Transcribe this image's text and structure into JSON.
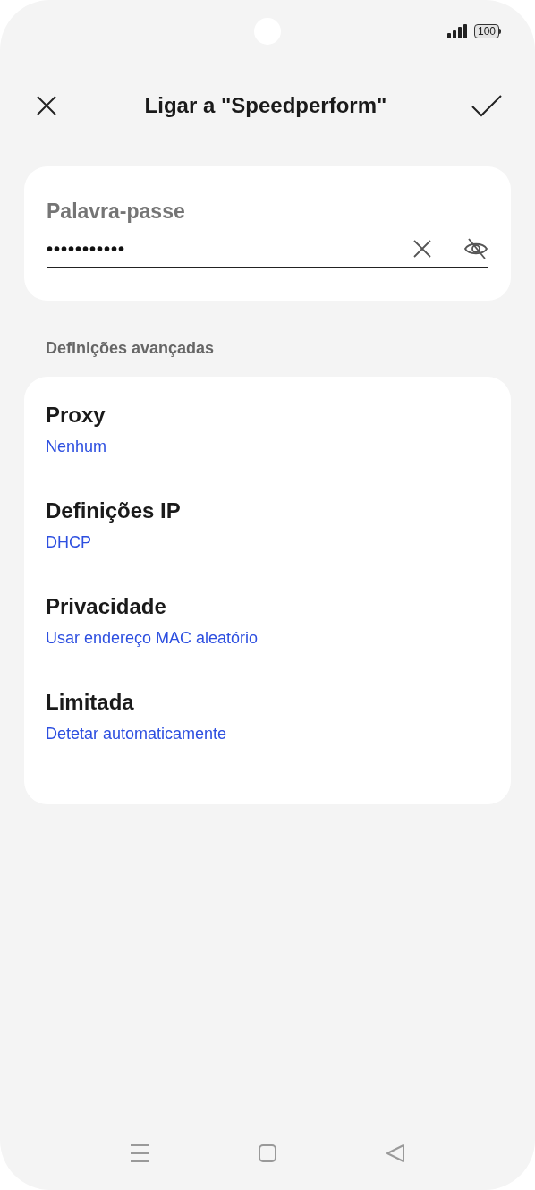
{
  "status_bar": {
    "battery": "100"
  },
  "header": {
    "title": "Ligar a \"Speedperform\""
  },
  "password": {
    "label": "Palavra-passe",
    "value": "•••••••••••"
  },
  "section_title": "Definições avançadas",
  "settings": [
    {
      "title": "Proxy",
      "value": "Nenhum"
    },
    {
      "title": "Definições IP",
      "value": "DHCP"
    },
    {
      "title": "Privacidade",
      "value": "Usar endereço MAC aleatório"
    },
    {
      "title": "Limitada",
      "value": "Detetar automaticamente"
    }
  ]
}
